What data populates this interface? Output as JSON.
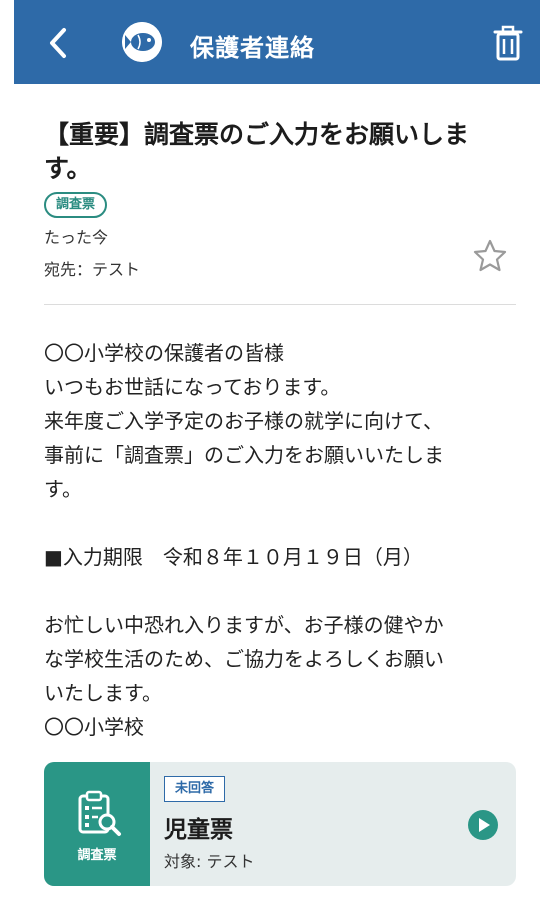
{
  "header": {
    "title": "保護者連絡",
    "color": "#2e6aa8"
  },
  "message": {
    "title": "【重要】調査票のご入力をお願いします。",
    "tag": "調査票",
    "time": "たった今",
    "recipient": "宛先：テスト",
    "body_lines": [
      "〇〇小学校の保護者の皆様",
      "いつもお世話になっております。",
      "来年度ご入学予定のお子様の就学に向けて、",
      "事前に「調査票」のご入力をお願いいたしま",
      "す。",
      "",
      "■入力期限　令和８年１０月１９日（月）",
      "",
      "お忙しい中恐れ入りますが、お子様の健やか",
      "な学校生活のため、ご協力をよろしくお願い",
      "いたします。",
      "〇〇小学校"
    ]
  },
  "card": {
    "icon_label": "調査票",
    "status": "未回答",
    "title": "児童票",
    "target": "対象: テスト",
    "accent": "#2a9686"
  },
  "icons": [
    "chevron-left-icon",
    "fish-logo-icon",
    "trash-icon",
    "star-outline-icon",
    "clipboard-search-icon",
    "play-circle-icon"
  ]
}
